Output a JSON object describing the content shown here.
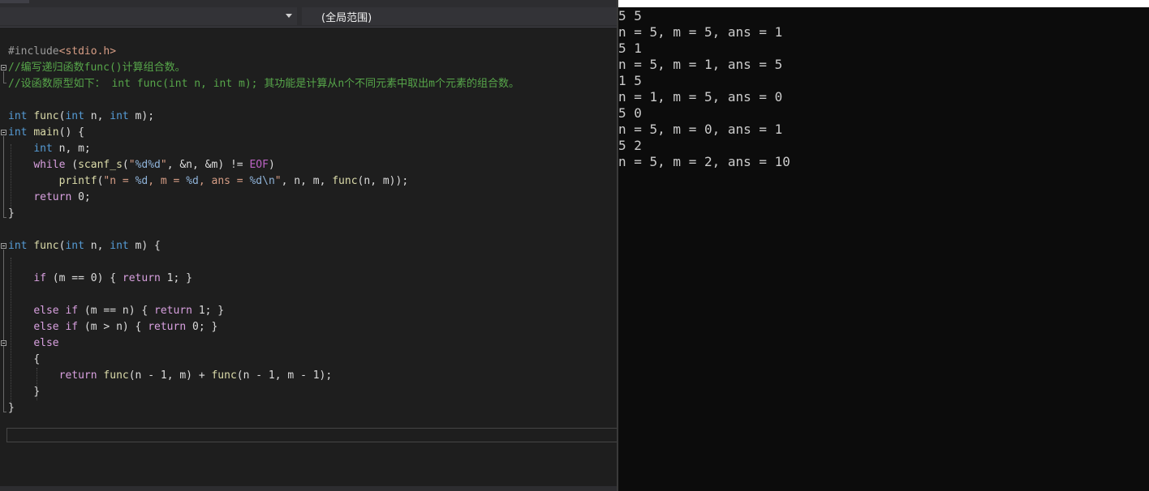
{
  "navbar": {
    "scope_label": "(全局范围)"
  },
  "code": {
    "l1": {
      "pp": "#include",
      "inc": "<stdio.h>"
    },
    "l2": {
      "comment": "//编写递归函数func()计算组合数。"
    },
    "l3": {
      "comment": "//设函数原型如下： int func(int n, int m); 其功能是计算从n个不同元素中取出m个元素的组合数。"
    },
    "l5": {
      "kw1": "int",
      "fn": "func",
      "p1": "(",
      "kw2": "int",
      "p2": " n, ",
      "kw3": "int",
      "p3": " m);"
    },
    "l6": {
      "kw1": "int",
      "fn": "main",
      "p1": "() {"
    },
    "l7": {
      "kw1": "int",
      "p1": " n, m;"
    },
    "l8": {
      "kw1": "while",
      "p1": " (",
      "fn": "scanf_s",
      "p2": "(",
      "st1": "\"",
      "fmt1": "%d%d",
      "st2": "\"",
      "p3": ", &n, &m) != ",
      "mac": "EOF",
      "p4": ")"
    },
    "l9": {
      "fn": "printf",
      "p1": "(",
      "st1": "\"n = ",
      "fmt1": "%d",
      "st2": ", m = ",
      "fmt2": "%d",
      "st3": ", ans = ",
      "fmt3": "%d\\n",
      "st4": "\"",
      "p2": ", n, m, ",
      "fn2": "func",
      "p3": "(n, m));"
    },
    "l10": {
      "kw1": "return",
      "p1": " 0;"
    },
    "l11": {
      "p1": "}"
    },
    "l14": {
      "kw1": "int",
      "fn": "func",
      "p1": "(",
      "kw2": "int",
      "p2": " n, ",
      "kw3": "int",
      "p3": " m) {"
    },
    "l16": {
      "kw1": "if",
      "p1": " (m == 0) { ",
      "kw2": "return",
      "p2": " 1; }"
    },
    "l18": {
      "kw1": "else",
      "kw2": "if",
      "p1": " (m == n) { ",
      "kw3": "return",
      "p2": " 1; }"
    },
    "l19": {
      "kw1": "else",
      "kw2": "if",
      "p1": " (m > n) { ",
      "kw3": "return",
      "p2": " 0; }"
    },
    "l20": {
      "kw1": "else"
    },
    "l21": {
      "p1": "{"
    },
    "l22": {
      "kw1": "return",
      "fn": "func",
      "p1": "(n - 1, m) + ",
      "fn2": "func",
      "p2": "(n - 1, m - 1);"
    },
    "l23": {
      "p1": "}"
    },
    "l24": {
      "p1": "}"
    }
  },
  "console": {
    "lines": [
      "5 5",
      "n = 5, m = 5, ans = 1",
      "5 1",
      "n = 5, m = 1, ans = 5",
      "1 5",
      "n = 1, m = 5, ans = 0",
      "5 0",
      "n = 5, m = 0, ans = 1",
      "5 2",
      "n = 5, m = 2, ans = 10"
    ]
  }
}
